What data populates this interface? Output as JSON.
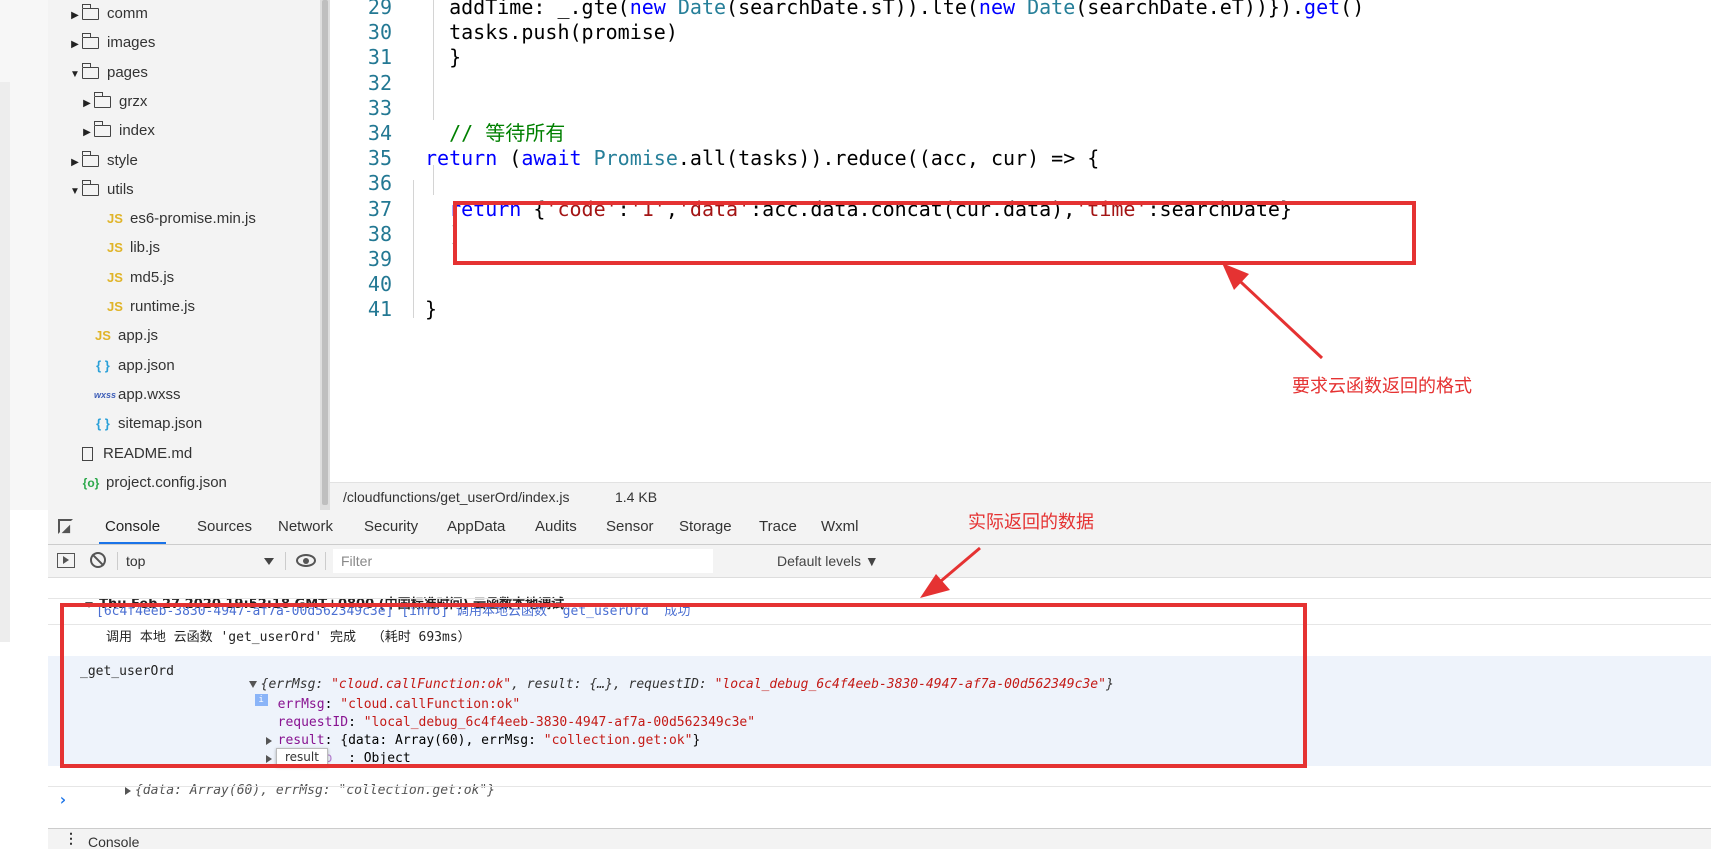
{
  "file_tree": [
    {
      "label": "comm",
      "type": "folder",
      "indent": 1,
      "expanded": false
    },
    {
      "label": "images",
      "type": "folder",
      "indent": 1,
      "expanded": false
    },
    {
      "label": "pages",
      "type": "folder",
      "indent": 1,
      "expanded": true
    },
    {
      "label": "grzx",
      "type": "folder",
      "indent": 2,
      "expanded": false
    },
    {
      "label": "index",
      "type": "folder",
      "indent": 2,
      "expanded": false
    },
    {
      "label": "style",
      "type": "folder",
      "indent": 1,
      "expanded": false
    },
    {
      "label": "utils",
      "type": "folder",
      "indent": 1,
      "expanded": true
    },
    {
      "label": "es6-promise.min.js",
      "type": "js",
      "indent": 3
    },
    {
      "label": "lib.js",
      "type": "js",
      "indent": 3
    },
    {
      "label": "md5.js",
      "type": "js",
      "indent": 3
    },
    {
      "label": "runtime.js",
      "type": "js",
      "indent": 3
    },
    {
      "label": "app.js",
      "type": "js",
      "indent": 2
    },
    {
      "label": "app.json",
      "type": "json",
      "indent": 2
    },
    {
      "label": "app.wxss",
      "type": "wxss",
      "indent": 2
    },
    {
      "label": "sitemap.json",
      "type": "json",
      "indent": 2
    },
    {
      "label": "README.md",
      "type": "doc",
      "indent": 1
    },
    {
      "label": "project.config.json",
      "type": "pc",
      "indent": 1
    }
  ],
  "icons": {
    "js": "JS",
    "json": "{ }",
    "wxss": "wxss",
    "pc": "{o}"
  },
  "code_lines": [
    {
      "num": "29",
      "tokens": [
        [
          "n",
          "  addTime: _.gte("
        ],
        [
          "kw",
          "new "
        ],
        [
          "ty",
          "Date"
        ],
        [
          "n",
          "(searchDate.sT)).lte("
        ],
        [
          "kw",
          "new "
        ],
        [
          "ty",
          "Date"
        ],
        [
          "n",
          "(searchDate.eT))})."
        ],
        [
          "kw",
          "get"
        ],
        [
          "n",
          "()"
        ]
      ]
    },
    {
      "num": "30",
      "tokens": [
        [
          "n",
          "  tasks.push(promise)"
        ]
      ]
    },
    {
      "num": "31",
      "tokens": [
        [
          "n",
          "  }"
        ]
      ]
    },
    {
      "num": "32",
      "tokens": []
    },
    {
      "num": "33",
      "tokens": []
    },
    {
      "num": "34",
      "tokens": [
        [
          "cm",
          "  // 等待所有"
        ]
      ]
    },
    {
      "num": "35",
      "tokens": [
        [
          "kw",
          "return "
        ],
        [
          "n",
          "("
        ],
        [
          "kw",
          "await "
        ],
        [
          "ty",
          "Promise"
        ],
        [
          "n",
          ".all(tasks)).reduce((acc, cur) => {"
        ]
      ]
    },
    {
      "num": "36",
      "tokens": []
    },
    {
      "num": "37",
      "tokens": [
        [
          "kw",
          "  return "
        ],
        [
          "n",
          "{"
        ],
        [
          "str",
          "'code'"
        ],
        [
          "n",
          ":"
        ],
        [
          "str",
          "'1'"
        ],
        [
          "n",
          ","
        ],
        [
          "str",
          "'data'"
        ],
        [
          "n",
          ":acc.data.concat(cur.data),"
        ],
        [
          "str",
          "'time'"
        ],
        [
          "n",
          ":searchDate}"
        ]
      ]
    },
    {
      "num": "38",
      "tokens": [
        [
          "n",
          "  )"
        ]
      ]
    },
    {
      "num": "39",
      "tokens": []
    },
    {
      "num": "40",
      "tokens": []
    },
    {
      "num": "41",
      "tokens": [
        [
          "n",
          "}"
        ]
      ]
    }
  ],
  "statusbar": {
    "path": "/cloudfunctions/get_userOrd/index.js",
    "size": "1.4 KB"
  },
  "devtools": {
    "tabs": [
      "Console",
      "Sources",
      "Network",
      "Security",
      "AppData",
      "Audits",
      "Sensor",
      "Storage",
      "Trace",
      "Wxml"
    ],
    "active_tab": "Console",
    "context": "top",
    "filter_placeholder": "Filter",
    "levels": "Default levels ▼"
  },
  "console": {
    "group_header": "Thu Feb 27 2020 19:52:18 GMT+0800 (中国标准时间) 云函数本地调试",
    "info_line": "[6c4f4eeb-3830-4947-af7a-00d562349c3e] [info] 调用本地云函数 `get_userOrd` 成功",
    "done_line": "调用 本地 云函数 'get_userOrd' 完成  （耗时 693ms）",
    "log_source": "_get_userOrd",
    "obj_summary_prefix": "{errMsg: ",
    "obj_summary_errmsg": "\"cloud.callFunction:ok\"",
    "obj_summary_mid": ", result: {…}, requestID: ",
    "obj_summary_reqid": "\"local_debug_6c4f4eeb-3830-4947-af7a-00d562349c3e\"",
    "obj_summary_suffix": "}",
    "errmsg_key": "errMsg",
    "errmsg_val": "\"cloud.callFunction:ok\"",
    "reqid_key": "requestID",
    "reqid_val": "\"local_debug_6c4f4eeb-3830-4947-af7a-00d562349c3e\"",
    "result_key": "result",
    "result_val_prefix": ": {data: Array(60), errMsg: ",
    "result_val_str": "\"collection.get:ok\"",
    "result_val_suffix": "}",
    "proto_key": "__proto__",
    "proto_val": ": Object",
    "tooltip": "result",
    "return_line": "{data: Array(60), errMsg: \"collection.get:ok\"}",
    "prompt": "›"
  },
  "drawer": {
    "label": "Console"
  },
  "annotations": {
    "top": "要求云函数返回的格式",
    "bottom": "实际返回的数据"
  },
  "colors": {
    "accent": "#1a73e8",
    "annotation": "#e53232",
    "keyword": "#0000ff",
    "type": "#267f99",
    "string": "#a31515",
    "comment": "#008000",
    "line_number": "#237893"
  }
}
